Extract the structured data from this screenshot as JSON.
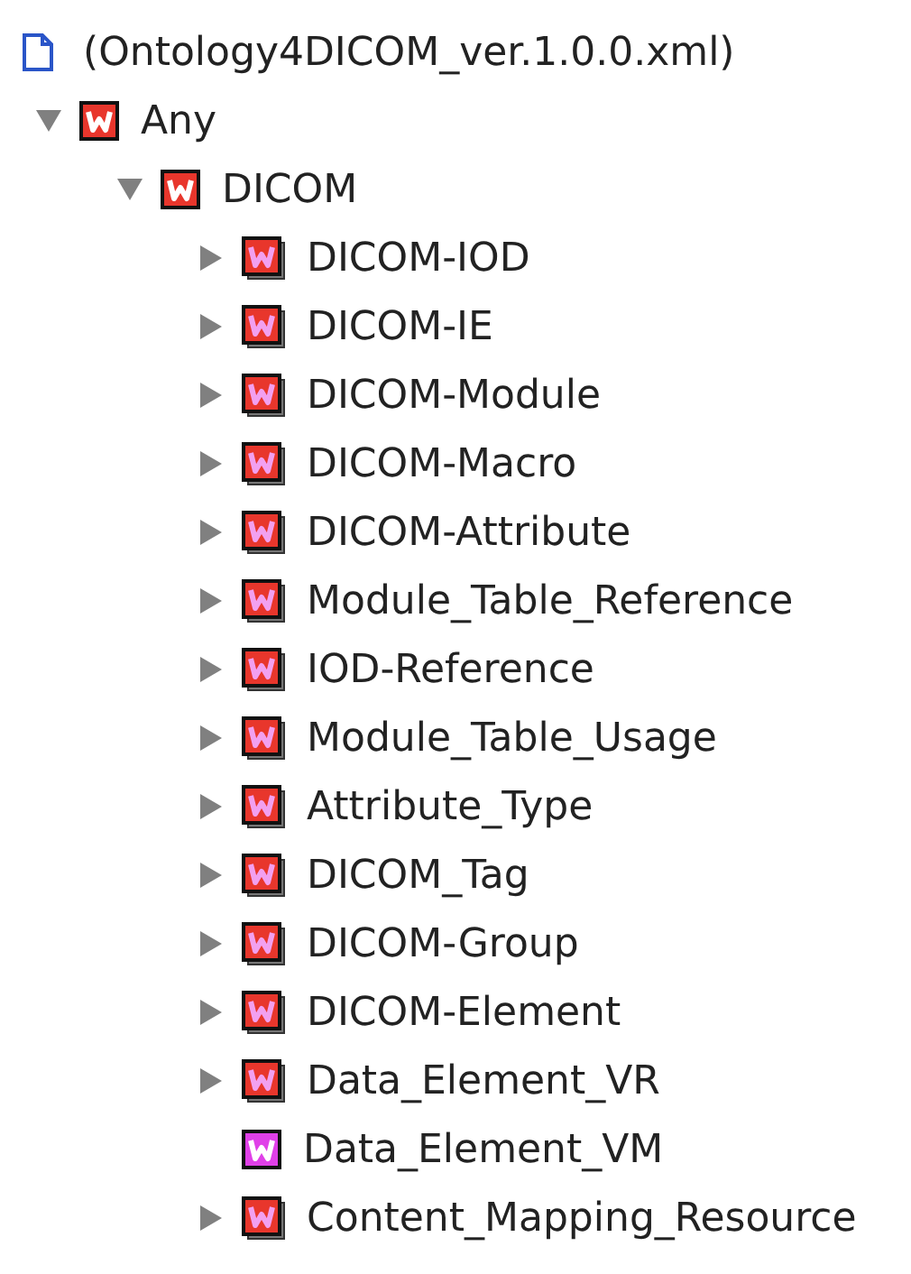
{
  "document": {
    "label": "(Ontology4DICOM_ver.1.0.0.xml)"
  },
  "tree": [
    {
      "label": "Any",
      "kind": "branch",
      "expanded": true,
      "children": [
        {
          "label": "DICOM",
          "kind": "branch",
          "expanded": true,
          "children": [
            {
              "label": "DICOM-IOD",
              "kind": "branch",
              "expanded": false
            },
            {
              "label": "DICOM-IE",
              "kind": "branch",
              "expanded": false
            },
            {
              "label": "DICOM-Module",
              "kind": "branch",
              "expanded": false
            },
            {
              "label": "DICOM-Macro",
              "kind": "branch",
              "expanded": false
            },
            {
              "label": "DICOM-Attribute",
              "kind": "branch",
              "expanded": false
            },
            {
              "label": "Module_Table_Reference",
              "kind": "branch",
              "expanded": false
            },
            {
              "label": "IOD-Reference",
              "kind": "branch",
              "expanded": false
            },
            {
              "label": "Module_Table_Usage",
              "kind": "branch",
              "expanded": false
            },
            {
              "label": "Attribute_Type",
              "kind": "branch",
              "expanded": false
            },
            {
              "label": "DICOM_Tag",
              "kind": "branch",
              "expanded": false
            },
            {
              "label": "DICOM-Group",
              "kind": "branch",
              "expanded": false
            },
            {
              "label": "DICOM-Element",
              "kind": "branch",
              "expanded": false
            },
            {
              "label": "Data_Element_VR",
              "kind": "branch",
              "expanded": false
            },
            {
              "label": "Data_Element_VM",
              "kind": "leaf"
            },
            {
              "label": "Content_Mapping_Resource",
              "kind": "branch",
              "expanded": false
            }
          ]
        }
      ]
    }
  ]
}
